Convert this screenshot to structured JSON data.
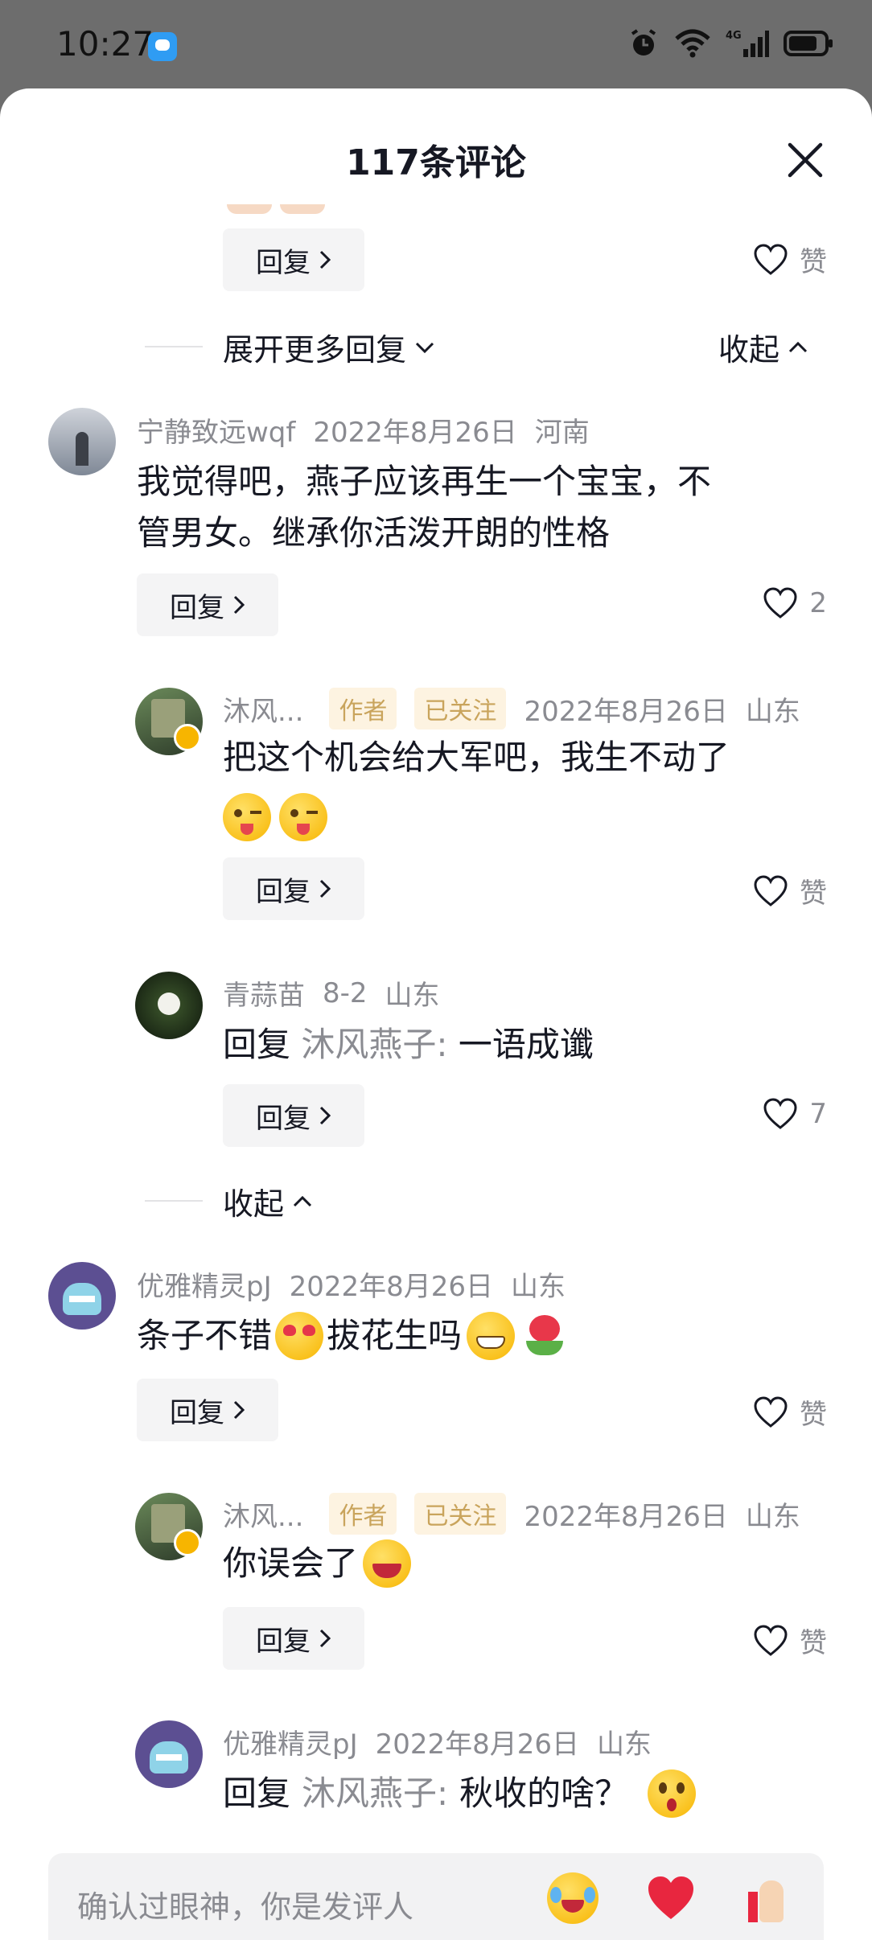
{
  "status": {
    "time": "10:27",
    "network": "4G"
  },
  "sheet": {
    "title": "117条评论"
  },
  "top_reply_label": "回复",
  "top_like_label": "赞",
  "expand_more": "展开更多回复",
  "collapse_label": "收起",
  "comments": [
    {
      "user": "宁静致远wqf",
      "date": "2022年8月26日",
      "location": "河南",
      "line1": "我觉得吧，燕子应该再生一个宝宝，不",
      "line2": "管男女。继承你活泼开朗的性格",
      "reply": "回复",
      "likes": "2"
    },
    {
      "user": "沐风...",
      "tag_author": "作者",
      "tag_followed": "已关注",
      "date": "2022年8月26日",
      "location": "山东",
      "text": "把这个机会给大军吧，我生不动了",
      "reply": "回复",
      "likes": "赞"
    },
    {
      "user": "青蒜苗",
      "date": "8-2",
      "location": "山东",
      "reply_prefix": "回复",
      "reply_to": "沐风燕子:",
      "text": "一语成谶",
      "reply": "回复",
      "likes": "7"
    },
    {
      "user": "优雅精灵pJ",
      "date": "2022年8月26日",
      "location": "山东",
      "text_a": "条子不错",
      "text_b": "拔花生吗",
      "reply": "回复",
      "likes": "赞"
    },
    {
      "user": "沐风...",
      "tag_author": "作者",
      "tag_followed": "已关注",
      "date": "2022年8月26日",
      "location": "山东",
      "text": "你误会了",
      "reply": "回复",
      "likes": "赞"
    },
    {
      "user": "优雅精灵pJ",
      "date": "2022年8月26日",
      "location": "山东",
      "reply_prefix": "回复",
      "reply_to": "沐风燕子:",
      "text": "秋收的啥？"
    }
  ],
  "input": {
    "placeholder": "确认过眼神，你是发评人"
  }
}
